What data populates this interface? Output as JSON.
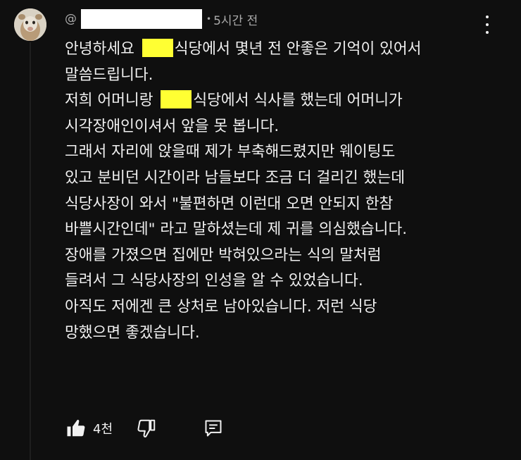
{
  "comment": {
    "handle_prefix": "@",
    "separator": "•",
    "timestamp": "5시간 전",
    "lines": [
      [
        "안녕하세요 ",
        "식당에서 몇년 전 안좋은 기억이 있어서"
      ],
      [
        "말씀드립니다."
      ],
      [
        "저희 어머니랑 ",
        "식당에서 식사를 했는데 어머니가"
      ],
      [
        "시각장애인이셔서 앞을 못 봅니다."
      ],
      [
        "그래서 자리에 앉을때 제가 부축해드렸지만 웨이팅도"
      ],
      [
        "있고 분비던 시간이라 남들보다 조금 더 걸리긴 했는데"
      ],
      [
        "식당사장이 와서 \"불편하면 이런대 오면 안되지 한참"
      ],
      [
        "바쁠시간인데\" 라고 말하셨는데 제 귀를 의심했습니다."
      ],
      [
        "장애를 가졌으면 집에만 박혀있으라는 식의 말처럼"
      ],
      [
        "들려서 그 식당사장의 인성을 알 수 있었습니다."
      ],
      [
        "아직도 저에겐 큰 상처로 남아있습니다. 저런 식당"
      ],
      [
        "망했으면 좋겠습니다."
      ]
    ]
  },
  "actions": {
    "like_count": "4천",
    "like_icon": "thumbs-up-icon",
    "dislike_icon": "thumbs-down-icon",
    "reply_icon": "reply-icon"
  },
  "colors": {
    "background": "#0f0f0f",
    "text": "#f1f1f1",
    "muted": "#aaaaaa",
    "redaction_yellow": "#ffff33",
    "redaction_white": "#ffffff"
  }
}
